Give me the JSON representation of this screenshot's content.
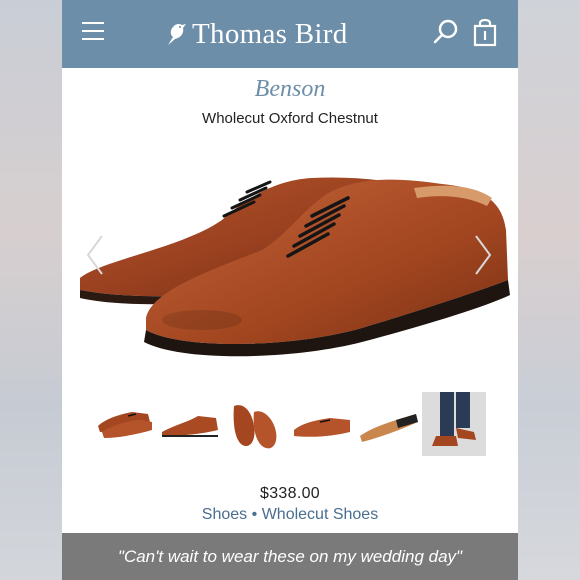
{
  "header": {
    "brand": "Thomas Bird",
    "menu_icon": "hamburger-menu-icon",
    "search_icon": "search-icon",
    "bag_icon": "shopping-bag-icon",
    "bar_color": "#6d8ea8"
  },
  "product": {
    "name": "Benson",
    "subtitle": "Wholecut Oxford Chestnut",
    "price": "$338.00",
    "breadcrumb": {
      "category": "Shoes",
      "separator": "•",
      "subcategory": "Wholecut Shoes"
    }
  },
  "gallery": {
    "prev_icon": "chevron-left-icon",
    "next_icon": "chevron-right-icon",
    "thumbnail_count": 6,
    "selected_index": 5
  },
  "caption": "\"Can't wait to wear these on my wedding day\""
}
